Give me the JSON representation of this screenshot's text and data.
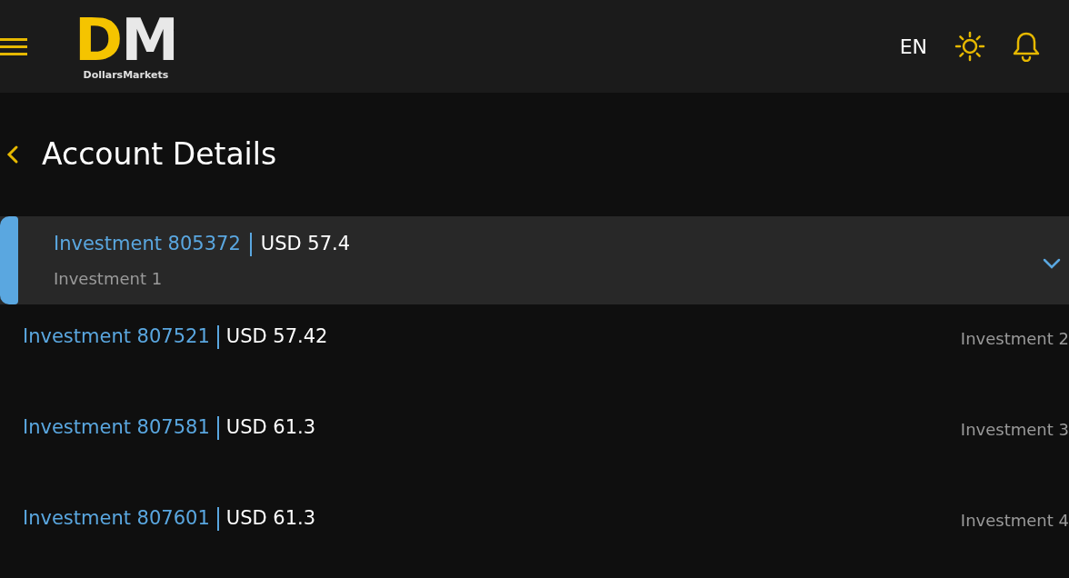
{
  "header": {
    "logo": {
      "monogram": "DM",
      "wordmark": "DollarsMarkets"
    },
    "language": "EN"
  },
  "page": {
    "title": "Account Details"
  },
  "accounts": [
    {
      "name": "Investment 805372",
      "balance": "USD 57.4",
      "label": "Investment 1",
      "selected": true
    },
    {
      "name": "Investment 807521",
      "balance": "USD 57.42",
      "label": "Investment 2",
      "selected": false
    },
    {
      "name": "Investment 807581",
      "balance": "USD 61.3",
      "label": "Investment 3",
      "selected": false
    },
    {
      "name": "Investment 807601",
      "balance": "USD 61.3",
      "label": "Investment 4",
      "selected": false
    }
  ]
}
